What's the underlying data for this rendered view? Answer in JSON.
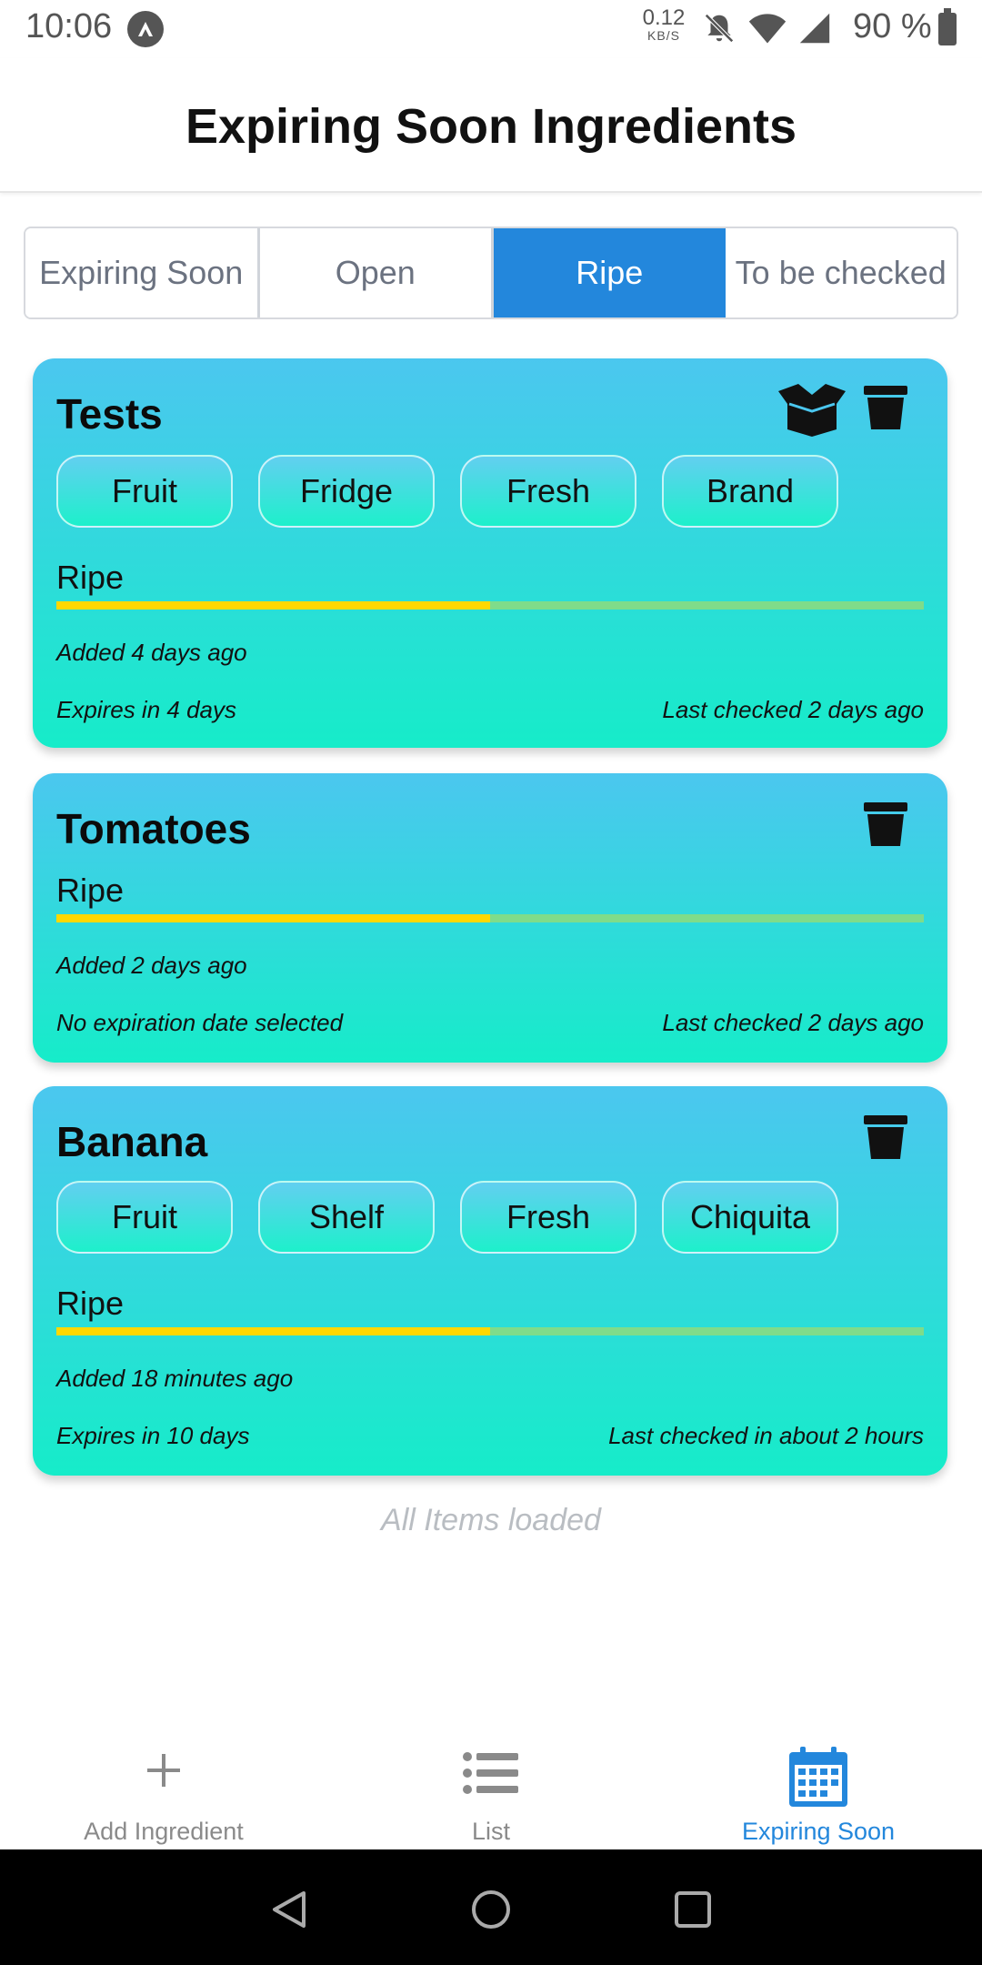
{
  "status_bar": {
    "time": "10:06",
    "net_speed_value": "0.12",
    "net_speed_unit": "KB/S",
    "battery_pct": "90 %"
  },
  "header": {
    "title": "Expiring Soon Ingredients"
  },
  "tabs": [
    {
      "label": "Expiring Soon",
      "active": false
    },
    {
      "label": "Open",
      "active": false
    },
    {
      "label": "Ripe",
      "active": true
    },
    {
      "label": "To be checked",
      "active": false
    }
  ],
  "cards": [
    {
      "title": "Tests",
      "chips": [
        "Fruit",
        "Fridge",
        "Fresh",
        "Brand"
      ],
      "status": "Ripe",
      "progress": 0.5,
      "added": "Added 4 days ago",
      "expires": "Expires in 4 days",
      "last_checked": "Last checked 2 days ago",
      "icons": [
        "open-box-icon",
        "trash-icon"
      ]
    },
    {
      "title": "Tomatoes",
      "chips": [],
      "status": "Ripe",
      "progress": 0.5,
      "added": "Added 2 days ago",
      "expires": "No expiration date selected",
      "last_checked": "Last checked 2 days ago",
      "icons": [
        "trash-icon"
      ]
    },
    {
      "title": "Banana",
      "chips": [
        "Fruit",
        "Shelf",
        "Fresh",
        "Chiquita"
      ],
      "status": "Ripe",
      "progress": 0.5,
      "added": "Added 18 minutes ago",
      "expires": "Expires in 10 days",
      "last_checked": "Last checked in about 2 hours",
      "icons": [
        "trash-icon"
      ]
    }
  ],
  "footer_text": "All Items loaded",
  "bottom_nav": [
    {
      "label": "Add Ingredient",
      "icon": "plus-icon",
      "active": false
    },
    {
      "label": "List",
      "icon": "list-icon",
      "active": false
    },
    {
      "label": "Expiring Soon",
      "icon": "calendar-icon",
      "active": true
    }
  ],
  "colors": {
    "accent": "#2387dc",
    "card_top": "#4bc7ef",
    "card_bottom": "#16ecc9",
    "progress_fill": "#ffd800",
    "progress_track": "#7fdc8a"
  }
}
